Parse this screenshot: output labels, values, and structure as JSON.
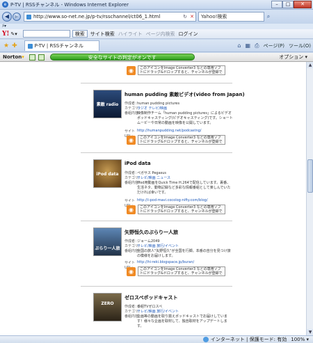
{
  "window": {
    "title": "P-TV | RSSチャンネル - Windows Internet Explorer",
    "min": "–",
    "max": "□",
    "close": "✕"
  },
  "address": {
    "url": "http://www.so-net.ne.jp/p-tv/rsschannel/ct06_1.html",
    "search_placeholder": "Yahoo!検索"
  },
  "menu": {
    "label": "ﾒ▾"
  },
  "yahoo": {
    "logo": "Y!",
    "search_button": "検索",
    "site_search": "サイト検索",
    "highlight": "ハイライト",
    "page_search": "ページ内検索",
    "login": "ログイン"
  },
  "tab": {
    "label": "P-TV | RSSチャンネル"
  },
  "commands": {
    "page": "ページ(P)",
    "tools": "ツール(O)"
  },
  "norton": {
    "brand": "Norton",
    "safe_text": "安全なサイトの判定がオンです",
    "options": "オプション ▾"
  },
  "rss_note": "このアイコンをImage Converter3 などの専用ソフトにドラッグ&ドロップすると、チャンネルが登録できます",
  "labels": {
    "author": "作成者：",
    "category": "カテゴリ：",
    "content": "番組内容：",
    "site": "サイトURL："
  },
  "feeds": [
    {
      "title": "human pudding 素敵ビデオ(video from Japan)",
      "author": "human pudding pictures",
      "category": "ラジオ テレビ/映画",
      "content": "映像制作チーム「human pudding pictures」によるビデオポッドキャスティング(ビデオキャスティング)です。ショートムービーや日常の動画を映像を公開しています。",
      "url": "http://humanpudding.net/podcastng/",
      "thumb": "素敵 radio"
    },
    {
      "title": "iPod data",
      "author": "ペガサス Pegasus",
      "category": "テレビ/映画 ニュース",
      "content": "iPod用動画をQuick Time H.264で配信しています。裏番、生活ネタ、動物記録など多彩な情報番組として楽しんでいただければ幸いです。",
      "url": "http://i-pod-mavi.cocolog-nifty.com/blog/",
      "thumb": "iPod data"
    },
    {
      "title": "矢野恒久のぶらり一人旅",
      "author": "ジョーム2049",
      "category": "テレビ/映画 旅行/イベント",
      "content": "全国の旅人\"矢野恒久\"が全国を行脚。本番の自分を見つけ旅の模様をお届けします。",
      "url": "http://hi-reki.blogspace.jp/buran/",
      "thumb": "ぶらり一人旅"
    },
    {
      "title": "ゼロスペポッドキャスト",
      "author": "番組TVゼロスペ",
      "category": "テレビ/映画 旅行/イベント",
      "content": "企画等の動画を取り揃えポッドキャストでお届けしています！様々な企画を取材して、独自取材をアップデートします。",
      "url": "",
      "thumb": "ZERO"
    }
  ],
  "status": {
    "zone": "インターネット | 保護モード: 有効",
    "zoom": "100% ▾"
  }
}
